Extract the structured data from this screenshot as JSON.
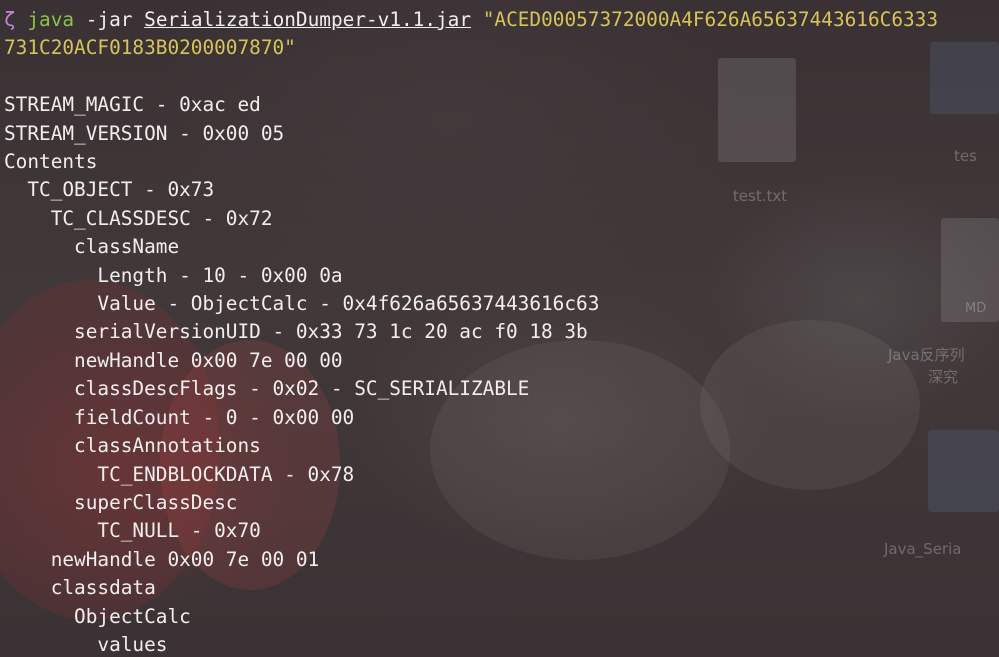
{
  "command": {
    "prompt_symbol": "ζ",
    "program": "java",
    "flag": "-jar",
    "jar": "SerializationDumper-v1.1.jar",
    "payload_part1": "\"ACED00057372000A4F626A65637443616C6333",
    "payload_part2": "731C20ACF0183B0200007870\""
  },
  "output": [
    {
      "indent": 0,
      "text": "STREAM_MAGIC - 0xac ed"
    },
    {
      "indent": 0,
      "text": "STREAM_VERSION - 0x00 05"
    },
    {
      "indent": 0,
      "text": "Contents"
    },
    {
      "indent": 1,
      "text": "TC_OBJECT - 0x73"
    },
    {
      "indent": 2,
      "text": "TC_CLASSDESC - 0x72"
    },
    {
      "indent": 3,
      "text": "className"
    },
    {
      "indent": 4,
      "text": "Length - 10 - 0x00 0a"
    },
    {
      "indent": 4,
      "text": "Value - ObjectCalc - 0x4f626a65637443616c63"
    },
    {
      "indent": 3,
      "text": "serialVersionUID - 0x33 73 1c 20 ac f0 18 3b"
    },
    {
      "indent": 3,
      "text": "newHandle 0x00 7e 00 00"
    },
    {
      "indent": 3,
      "text": "classDescFlags - 0x02 - SC_SERIALIZABLE"
    },
    {
      "indent": 3,
      "text": "fieldCount - 0 - 0x00 00"
    },
    {
      "indent": 3,
      "text": "classAnnotations"
    },
    {
      "indent": 4,
      "text": "TC_ENDBLOCKDATA - 0x78"
    },
    {
      "indent": 3,
      "text": "superClassDesc"
    },
    {
      "indent": 4,
      "text": "TC_NULL - 0x70"
    },
    {
      "indent": 2,
      "text": "newHandle 0x00 7e 00 01"
    },
    {
      "indent": 2,
      "text": "classdata"
    },
    {
      "indent": 3,
      "text": "ObjectCalc"
    },
    {
      "indent": 4,
      "text": "values"
    }
  ],
  "desktop": {
    "file_1": "test.txt",
    "file_2_partial": "tes",
    "file_3_partial": "MD",
    "file_4_partial_a": "Java反序列",
    "file_4_partial_b": "深究",
    "file_5_partial": "Java_Seria"
  },
  "colors": {
    "prompt": "#c084d8",
    "command": "#8bc34a",
    "string": "#d8c35a",
    "text": "#f2eeee"
  }
}
